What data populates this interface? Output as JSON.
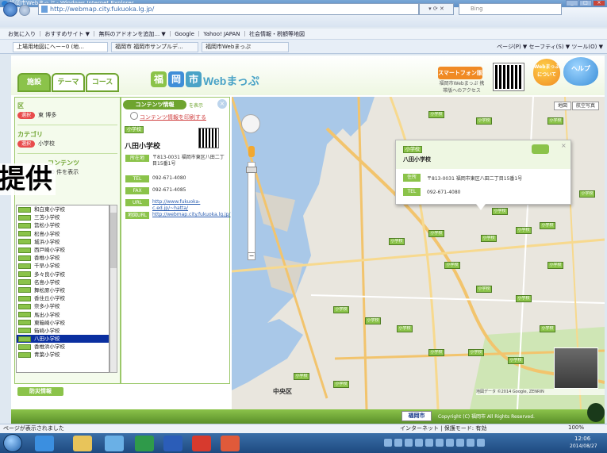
{
  "browser": {
    "title": "福岡市Webまっぷ - Windows Internet Explorer",
    "url": "http://webmap.city.fukuoka.lg.jp/",
    "search_placeholder": "Bing",
    "favorites_bar": "お気に入り ｜ おすすめサイト ▼ ｜ 無料のアドオンを追加... ▼ ｜ Google ｜ Yahoo! JAPAN ｜ 社会情報・税額等地図",
    "tabs": [
      "上場用地図にへー~0 (地...",
      "福岡市 福岡市サンプルデ...",
      "福岡市Webまっぷ"
    ],
    "command_bar": "ページ(P) ▼ セーフティ(S) ▼ ツール(O) ▼"
  },
  "header": {
    "tabs": [
      "施設",
      "テーマ",
      "コース"
    ],
    "logo_chars": [
      "福",
      "岡",
      "市"
    ],
    "logo_text": "Webまっぷ",
    "mobile_badge": "スマートフォン版",
    "mobile_note": "福岡市Webまっぷ 携帯版へのアクセス",
    "balloon_left": "Webまっぷ について",
    "balloon_right": "ヘルプ"
  },
  "left_panel": {
    "section_ward": {
      "title": "区",
      "pill": "選択",
      "value": "東 博多"
    },
    "section_category": {
      "title": "カテゴリ",
      "pill": "選択",
      "value": "小学校"
    },
    "section_content": {
      "title": "コンテンツ",
      "count_text": "40 件を表示"
    },
    "overlay_text": "提供",
    "facilities": [
      "和白東小学校",
      "三苫小学校",
      "筥松小学校",
      "松島小学校",
      "城浜小学校",
      "西戸崎小学校",
      "香椎小学校",
      "千早小学校",
      "多々良小学校",
      "名島小学校",
      "舞松原小学校",
      "香住丘小学校",
      "奈多小学校",
      "馬出小学校",
      "東箱崎小学校",
      "箱崎小学校",
      "八田小学校",
      "香椎浜小学校",
      "青葉小学校"
    ],
    "selected_index": 16,
    "bottom_tag": "防災情報"
  },
  "detail_panel": {
    "tab_label": "コンテンツ情報",
    "tab_sub": "を表示",
    "link_label": "コンテンツ情報を印刷する",
    "badge": "小学校",
    "name": "八田小学校",
    "rows": [
      {
        "key": "所在地",
        "value": "〒813-0031 福岡市東区八田二丁目15番1号"
      },
      {
        "key": "TEL",
        "value": "092-671-4080"
      },
      {
        "key": "FAX",
        "value": "092-671-4085"
      },
      {
        "key": "URL",
        "value": "http://www.fukuoka-c.ed.jp/~hatta/"
      },
      {
        "key": "地図URL",
        "value": "http://webmap.city.fukuoka.lg.jp/"
      }
    ]
  },
  "map": {
    "type_buttons": [
      "地図",
      "航空写真"
    ],
    "district_label": "中央区",
    "copyright": "地図データ ©2014 Google, ZENRIN",
    "info_window": {
      "badge": "小学校",
      "name": "八田小学校",
      "address_key": "住所",
      "address": "〒813-0031 福岡市東区八田二丁目15番1号",
      "tel_key": "TEL",
      "tel": "092-671-4080"
    },
    "marker_label": "小学校"
  },
  "footer": {
    "logo": "福岡市",
    "copyright": "Copyright (C) 福岡市 All Rights Reserved."
  },
  "status": {
    "left": "ページが表示されました",
    "mid": "インターネット | 保護モード: 有効",
    "zoom": "100%"
  },
  "taskbar": {
    "time": "12:06",
    "date": "2014/08/27"
  },
  "colors": {
    "accent_green": "#8bc34a",
    "dark_green": "#6ea42f",
    "brand_blue": "#4aa3c7",
    "selection": "#0a2fa0",
    "pill_red": "#e84c4c"
  }
}
